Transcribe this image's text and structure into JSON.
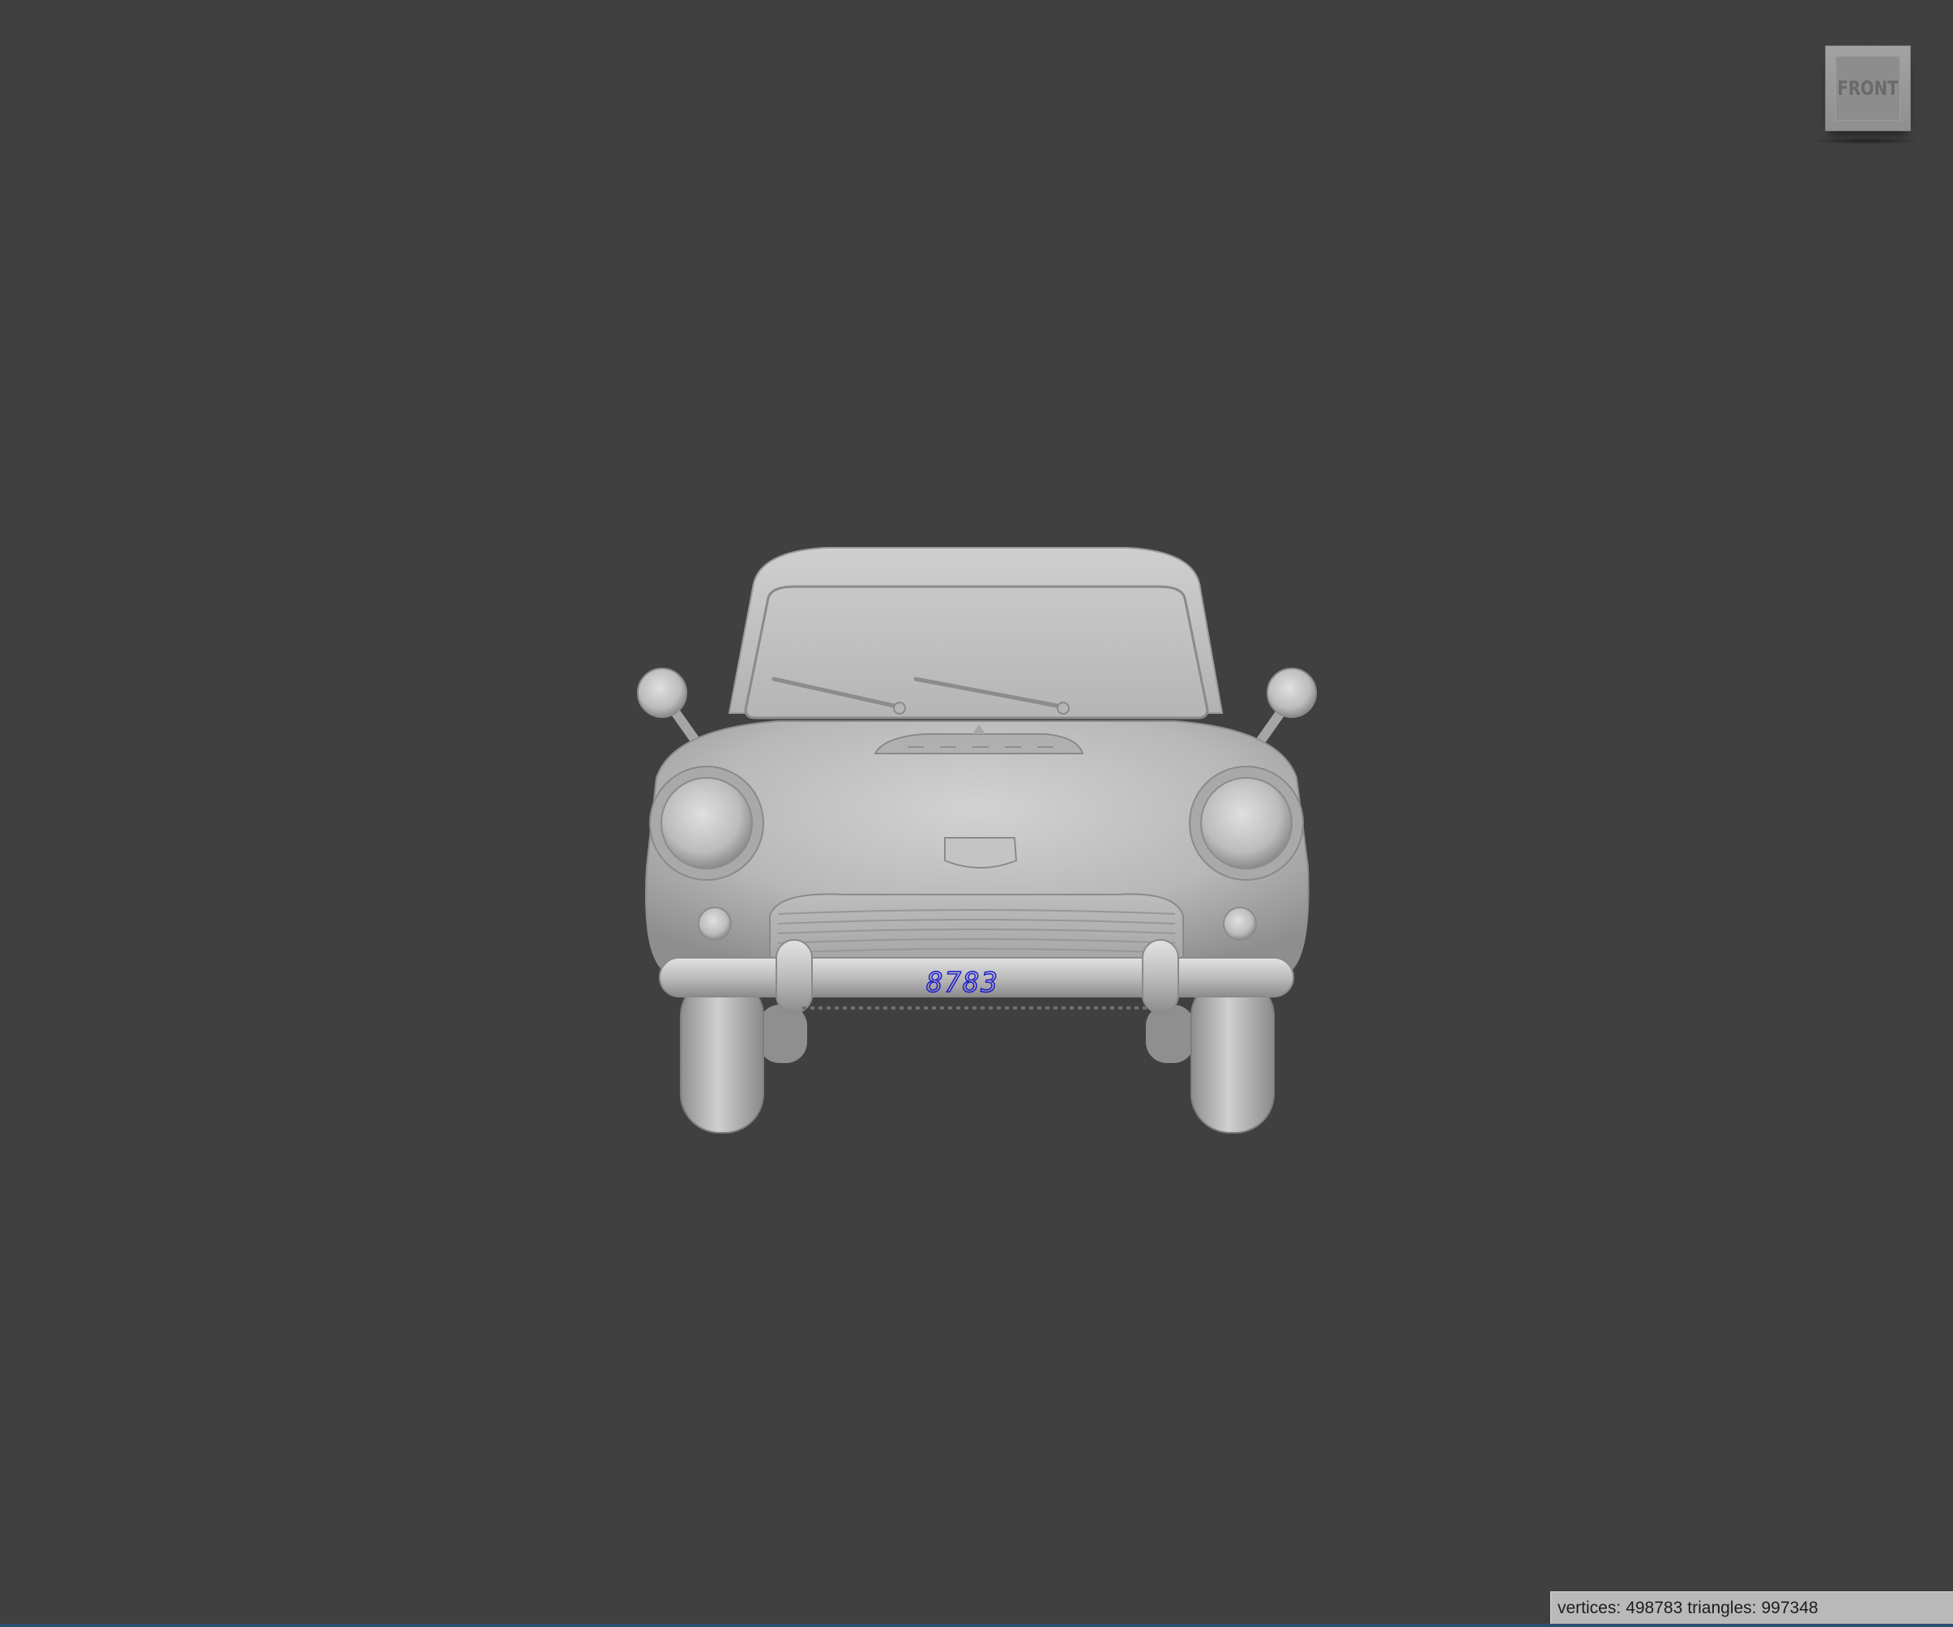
{
  "viewport": {
    "background": "#414040"
  },
  "view_cube": {
    "face_label": "FRONT"
  },
  "model": {
    "license_plate_text": "8783",
    "plate_color": "#2222cc"
  },
  "status": {
    "vertices_label": "vertices:",
    "vertices_value": "498783",
    "triangles_label": "triangles:",
    "triangles_value": "997348"
  }
}
